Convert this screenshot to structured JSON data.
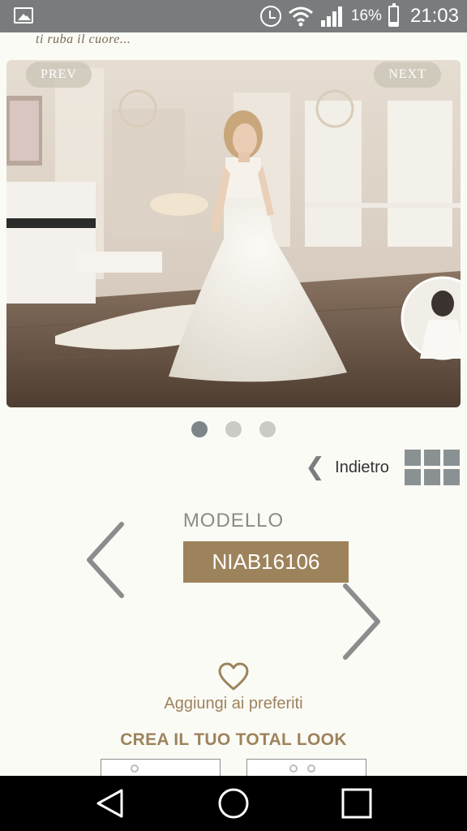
{
  "status_bar": {
    "battery": "16%",
    "time": "21:03",
    "icons": [
      "gallery-icon",
      "alarm-icon",
      "wifi-icon",
      "signal-icon",
      "battery-icon"
    ]
  },
  "header": {
    "tagline": "ti ruba il cuore..."
  },
  "gallery": {
    "prev_label": "PREV",
    "next_label": "NEXT",
    "slides_count": 3,
    "active_slide": 1
  },
  "navigation": {
    "back_label": "Indietro",
    "back_icon": "chevron-left-icon",
    "grid_icon": "grid-view-icon"
  },
  "product": {
    "model_label": "MODELLO",
    "model_code": "NIAB16106"
  },
  "favorites": {
    "icon": "heart-icon",
    "label": "Aggiungi ai preferiti"
  },
  "total_look": {
    "title": "CREA IL TUO TOTAL LOOK"
  },
  "system_nav": {
    "icons": [
      "back-icon",
      "home-icon",
      "recent-apps-icon"
    ]
  },
  "colors": {
    "accent": "#9d835c",
    "status_bar": "#787c7d",
    "background": "#fbfbf6"
  }
}
